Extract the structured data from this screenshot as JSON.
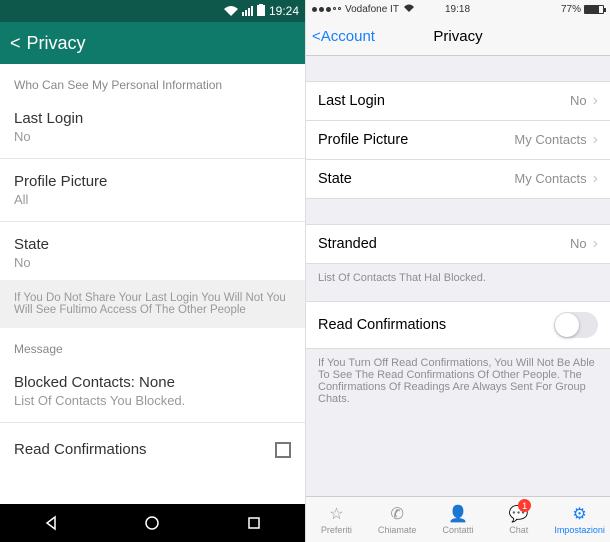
{
  "left": {
    "status": {
      "time": "19:24"
    },
    "header": {
      "back": "<",
      "title": "Privacy"
    },
    "sectionHeader": "Who Can See My Personal Information",
    "lastLogin": {
      "label": "Last Login",
      "value": "No"
    },
    "profilePic": {
      "label": "Profile Picture",
      "value": "All"
    },
    "state": {
      "label": "State",
      "value": "No"
    },
    "note": "If You Do Not Share Your Last Login You Will Not You Will See Fultimo Access Of The Other People",
    "messageHeader": "Message",
    "blocked": {
      "label": "Blocked Contacts: None",
      "sub": "List Of Contacts You Blocked."
    },
    "readConfirm": {
      "label": "Read Confirmations"
    }
  },
  "right": {
    "status": {
      "carrier": "Vodafone IT",
      "time": "19:18",
      "battery": "77%"
    },
    "header": {
      "back": "Account",
      "title": "Privacy"
    },
    "lastLogin": {
      "label": "Last Login",
      "value": "No"
    },
    "profilePic": {
      "label": "Profile Picture",
      "value": "My Contacts"
    },
    "state": {
      "label": "State",
      "value": "My Contacts"
    },
    "stranded": {
      "label": "Stranded",
      "value": "No"
    },
    "blockedNote": "List Of Contacts That Hal Blocked.",
    "readConfirm": {
      "label": "Read Confirmations"
    },
    "readNote": "If You Turn Off Read Confirmations, You Will Not Be Able To See The Read Confirmations Of Other People. The Confirmations Of Readings Are Always Sent For Group Chats.",
    "tabs": {
      "fav": "Preferiti",
      "calls": "Chiamate",
      "contacts": "Contatti",
      "chat": "Chat",
      "settings": "Impostazioni",
      "chatBadge": "1"
    }
  }
}
